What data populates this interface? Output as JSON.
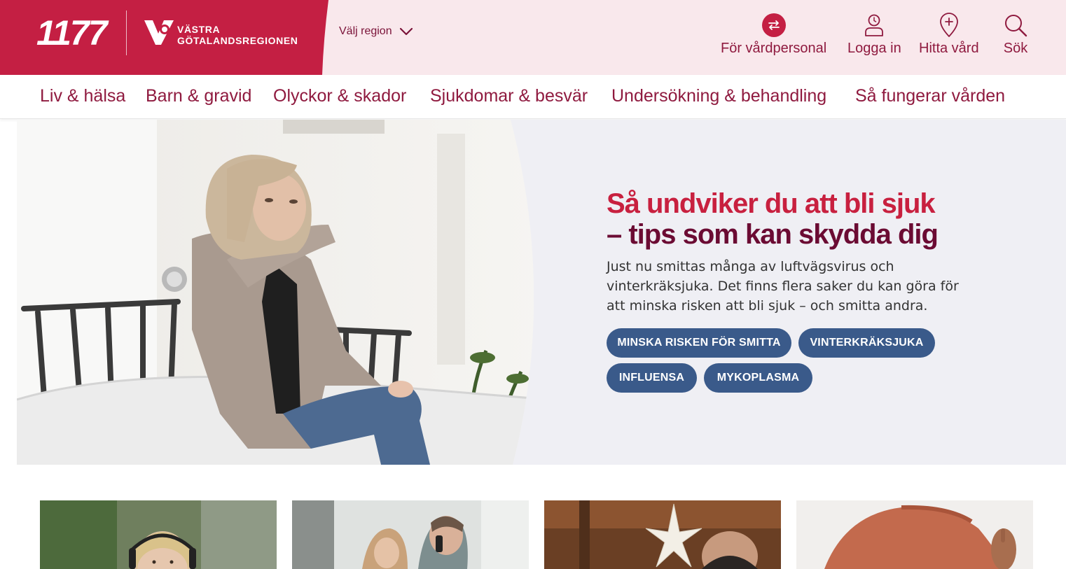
{
  "brand": {
    "logo_text": "1177",
    "region_org_line1": "VÄSTRA",
    "region_org_line2": "GÖTALANDSREGIONEN"
  },
  "region_selector": {
    "label": "Välj region",
    "icon": "chevron-down-icon"
  },
  "utility_nav": {
    "staff": {
      "label": "För vårdpersonal",
      "icon": "swap-arrows-icon"
    },
    "login": {
      "label": "Logga in",
      "icon": "user-icon"
    },
    "find_care": {
      "label": "Hitta vård",
      "icon": "map-pin-plus-icon"
    },
    "search": {
      "label": "Sök",
      "icon": "search-icon"
    }
  },
  "main_nav": {
    "items": [
      {
        "label": "Liv & hälsa"
      },
      {
        "label": "Barn & gravid"
      },
      {
        "label": "Olyckor & skador"
      },
      {
        "label": "Sjukdomar & besvär"
      },
      {
        "label": "Undersökning & behandling"
      },
      {
        "label": "Så fungerar vården"
      }
    ]
  },
  "hero": {
    "title_line1": "Så undviker du att bli sjuk",
    "title_line2": "– tips som kan skydda dig",
    "body": "Just nu smittas många av luftvägsvirus och vinterkräksjuka. Det finns flera saker du kan göra för att minska risken att bli sjuk – och smitta andra.",
    "buttons": [
      {
        "label": "MINSKA RISKEN FÖR SMITTA"
      },
      {
        "label": "VINTERKRÄKSJUKA"
      },
      {
        "label": "INFLUENSA"
      },
      {
        "label": "MYKOPLASMA"
      }
    ]
  },
  "colors": {
    "brand_red": "#c41f43",
    "header_pink": "#f9e8ec",
    "nav_text": "#8f1a3f",
    "title_dark": "#6b0b33",
    "pill_blue": "#3a5a8a",
    "hero_bg": "#efeff4"
  }
}
